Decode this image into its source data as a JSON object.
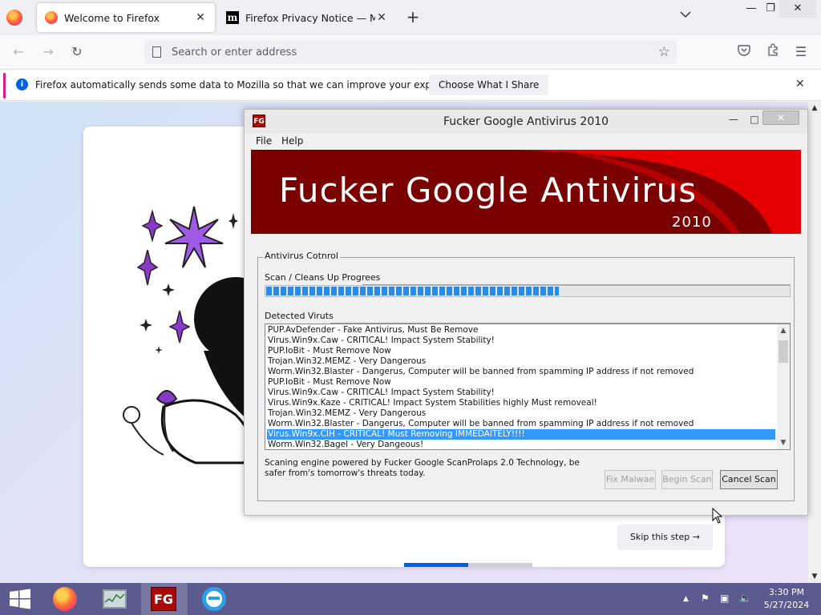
{
  "browser": {
    "tabs": [
      {
        "title": "Welcome to Firefox",
        "active": true
      },
      {
        "title": "Firefox Privacy Notice — Mozill",
        "active": false
      }
    ],
    "address_placeholder": "Search or enter address",
    "notification": {
      "message": "Firefox automatically sends some data to Mozilla so that we can improve your experience.",
      "button": "Choose What I Share"
    }
  },
  "page": {
    "skip_label": "Skip this step →",
    "progress": {
      "current_step": 1,
      "total_steps": 2
    }
  },
  "antivirus": {
    "icon_text": "FG",
    "title": "Fucker Google Antivirus 2010",
    "menu": [
      "File",
      "Help"
    ],
    "banner": {
      "title": "Fucker Google Antivirus",
      "year": "2010"
    },
    "group_label": "Antivirus Cotnrol",
    "scan_label": "Scan / Cleans Up Progrees",
    "scan_progress": 0.56,
    "detected_label": "Detected Viruts",
    "viruses": [
      "PUP.AvDefender - Fake Antivirus, Must Be Remove",
      "Virus.Win9x.Caw - CRITICAL! Impact System Stability!",
      "PUP.IoBit - Must Remove Now",
      "Trojan.Win32.MEMZ - Very Dangerous",
      "Worm.Win32.Blaster - Dangerus, Computer will be banned from spamming IP address if not removed",
      "PUP.IoBit - Must Remove Now",
      "Virus.Win9x.Caw - CRITICAL! Impact System Stability!",
      "Virus.Win9x.Kaze - CRITICAL! Impact System Stabilities highly Must removeal!",
      "Trojan.Win32.MEMZ - Very Dangerous",
      "Worm.Win32.Blaster - Dangerus, Computer will be banned from spamming IP address if not removed",
      "Virus.Win9x.CIH - CRITICAL! Must Removing IMMEDAITELY!!!!",
      "Worm.Win32.Bagel - Very Dangeous!"
    ],
    "selected_index": 10,
    "description": "Scaning engine powered by Fucker Google ScanProlaps 2.0 Technology, be safer from's tomorrow's threats today.",
    "buttons": {
      "fix": "Fix Malwae",
      "begin": "Begin Scan",
      "cancel": "Cancel Scan"
    }
  },
  "taskbar": {
    "items": [
      "firefox",
      "task-manager",
      "fucker-google-antivirus",
      "internet-explorer"
    ],
    "av_icon_text": "FG",
    "clock": {
      "time": "3:30 PM",
      "date": "5/27/2024"
    }
  }
}
